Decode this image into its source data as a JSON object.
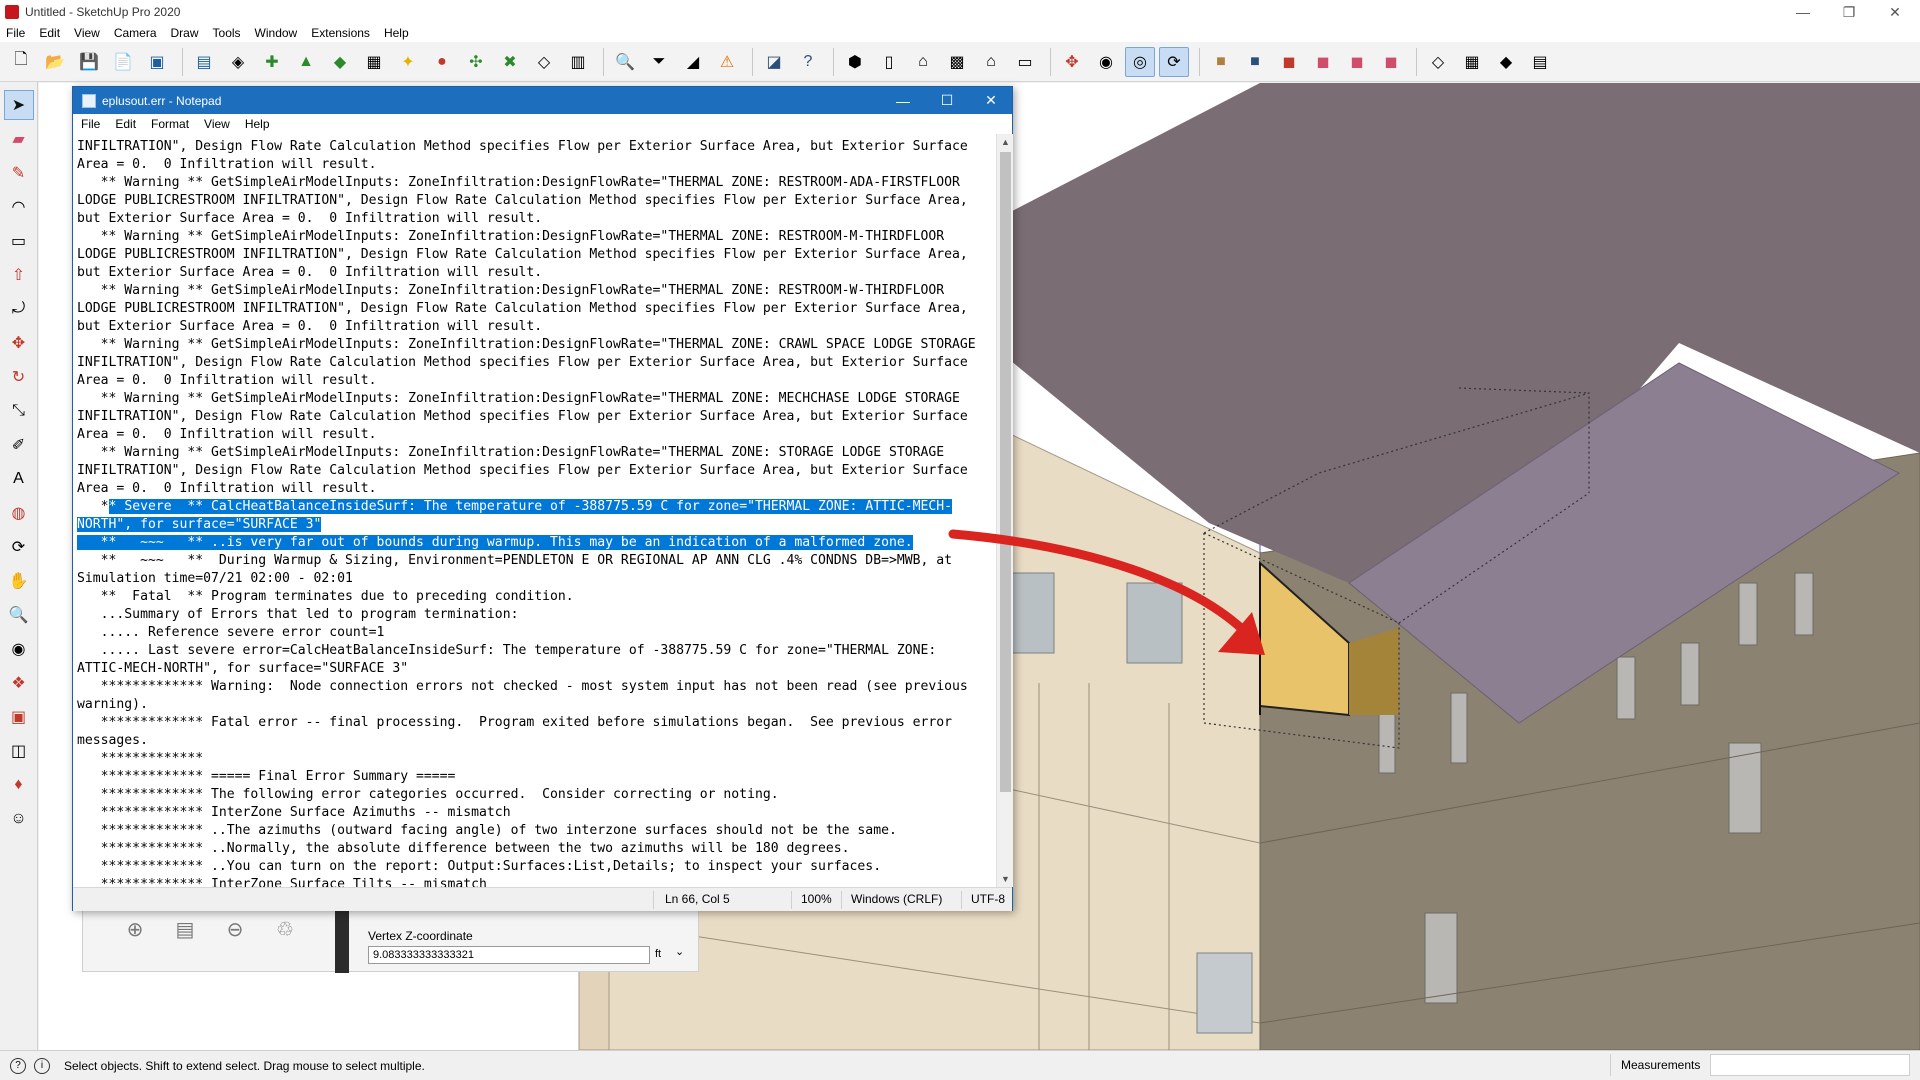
{
  "window": {
    "title": "Untitled - SketchUp Pro 2020",
    "controls": {
      "minimize": "—",
      "restore": "❐",
      "close": "✕"
    }
  },
  "menubar": [
    "File",
    "Edit",
    "View",
    "Camera",
    "Draw",
    "Tools",
    "Window",
    "Extensions",
    "Help"
  ],
  "toolbar_icons": [
    "new-file-icon",
    "open-folder-icon",
    "save-icon",
    "open-idf-icon",
    "idf-icon",
    "idf-export-icon",
    "space-icon",
    "thermal-zone-icon",
    "building-icon",
    "construction-icon",
    "schedule-icon",
    "light-icon",
    "air-loop-icon",
    "plant-loop-icon",
    "water-icon",
    "shading-icon",
    "grid-icon",
    "search-icon",
    "filter-icon",
    "render-mode-icon",
    "warning-icon",
    "inspector-icon",
    "help-icon",
    "iso-view-icon",
    "front-view-icon",
    "house-icon",
    "building-view-icon",
    "house-outline-icon",
    "garage-icon",
    "move-icon",
    "zoom-extents-icon",
    "zoom-window-icon",
    "orbit-icon",
    "box-icon",
    "box-dark-icon",
    "shape-red-icon",
    "shape-pink-icon",
    "shape-pink2-icon",
    "shape-pink3-icon",
    "wireframe-icon",
    "grid-cube-icon",
    "solid-cube-icon",
    "calendar-icon"
  ],
  "left_tools": [
    "select-arrow-icon",
    "eraser-icon",
    "pencil-icon",
    "arc-icon",
    "rectangle-icon",
    "push-pull-icon",
    "offset-icon",
    "move-icon",
    "rotate-icon",
    "scale-icon",
    "tape-measure-icon",
    "text-icon",
    "paint-bucket-icon",
    "orbit-icon",
    "pan-icon",
    "zoom-icon",
    "zoom-extents-icon",
    "component-icon",
    "warehouse-icon",
    "extension-icon",
    "ruby-icon",
    "profile-icon"
  ],
  "notepad": {
    "title": "eplusout.err - Notepad",
    "menu": [
      "File",
      "Edit",
      "Format",
      "View",
      "Help"
    ],
    "lines": [
      "INFILTRATION\", Design Flow Rate Calculation Method specifies Flow per Exterior Surface Area, but Exterior Surface",
      "Area = 0.  0 Infiltration will result.",
      "   ** Warning ** GetSimpleAirModelInputs: ZoneInfiltration:DesignFlowRate=\"THERMAL ZONE: RESTROOM-ADA-FIRSTFLOOR",
      "LODGE PUBLICRESTROOM INFILTRATION\", Design Flow Rate Calculation Method specifies Flow per Exterior Surface Area,",
      "but Exterior Surface Area = 0.  0 Infiltration will result.",
      "   ** Warning ** GetSimpleAirModelInputs: ZoneInfiltration:DesignFlowRate=\"THERMAL ZONE: RESTROOM-M-THIRDFLOOR",
      "LODGE PUBLICRESTROOM INFILTRATION\", Design Flow Rate Calculation Method specifies Flow per Exterior Surface Area,",
      "but Exterior Surface Area = 0.  0 Infiltration will result.",
      "   ** Warning ** GetSimpleAirModelInputs: ZoneInfiltration:DesignFlowRate=\"THERMAL ZONE: RESTROOM-W-THIRDFLOOR",
      "LODGE PUBLICRESTROOM INFILTRATION\", Design Flow Rate Calculation Method specifies Flow per Exterior Surface Area,",
      "but Exterior Surface Area = 0.  0 Infiltration will result.",
      "   ** Warning ** GetSimpleAirModelInputs: ZoneInfiltration:DesignFlowRate=\"THERMAL ZONE: CRAWL SPACE LODGE STORAGE",
      "INFILTRATION\", Design Flow Rate Calculation Method specifies Flow per Exterior Surface Area, but Exterior Surface",
      "Area = 0.  0 Infiltration will result.",
      "   ** Warning ** GetSimpleAirModelInputs: ZoneInfiltration:DesignFlowRate=\"THERMAL ZONE: MECHCHASE LODGE STORAGE",
      "INFILTRATION\", Design Flow Rate Calculation Method specifies Flow per Exterior Surface Area, but Exterior Surface",
      "Area = 0.  0 Infiltration will result.",
      "   ** Warning ** GetSimpleAirModelInputs: ZoneInfiltration:DesignFlowRate=\"THERMAL ZONE: STORAGE LODGE STORAGE",
      "INFILTRATION\", Design Flow Rate Calculation Method specifies Flow per Exterior Surface Area, but Exterior Surface",
      "Area = 0.  0 Infiltration will result.",
      "   *",
      "",
      "   **   ~~~   ** ..is very far out of bounds during warmup. This may be an indication of a malformed zone.",
      "   **   ~~~   **  During Warmup & Sizing, Environment=PENDLETON E OR REGIONAL AP ANN CLG .4% CONDNS DB=>MWB, at",
      "Simulation time=07/21 02:00 - 02:01",
      "   **  Fatal  ** Program terminates due to preceding condition.",
      "   ...Summary of Errors that led to program termination:",
      "   ..... Reference severe error count=1",
      "   ..... Last severe error=CalcHeatBalanceInsideSurf: The temperature of -388775.59 C for zone=\"THERMAL ZONE:",
      "ATTIC-MECH-NORTH\", for surface=\"SURFACE 3\"",
      "   ************* Warning:  Node connection errors not checked - most system input has not been read (see previous",
      "warning).",
      "   ************* Fatal error -- final processing.  Program exited before simulations began.  See previous error",
      "messages.",
      "   *************",
      "   ************* ===== Final Error Summary =====",
      "   ************* The following error categories occurred.  Consider correcting or noting.",
      "   ************* InterZone Surface Azimuths -- mismatch",
      "   ************* ..The azimuths (outward facing angle) of two interzone surfaces should not be the same.",
      "   ************* ..Normally, the absolute difference between the two azimuths will be 180 degrees.",
      "   ************* ..You can turn on the report: Output:Surfaces:List,Details; to inspect your surfaces.",
      "   ************* InterZone Surface Tilts -- mismatch"
    ],
    "highlight": {
      "line20": "* Severe  ** CalcHeatBalanceInsideSurf: The temperature of -388775.59 C for zone=\"THERMAL ZONE: ATTIC-MECH-",
      "line21": "NORTH\", for surface=\"SURFACE 3\"",
      "line22_prefix": "   **   ~~~   ** ..is very far out of bounds during warmup. This may be an indication of a malformed zone."
    },
    "status": {
      "position": "Ln 66, Col 5",
      "zoom": "100%",
      "line_ending": "Windows (CRLF)",
      "encoding": "UTF-8"
    }
  },
  "entity_info": {
    "vertex_label": "Vertex Z-coordinate",
    "vertex_value": "9.083333333333321",
    "unit": "ft"
  },
  "statusbar": {
    "text": "Select objects. Shift to extend select. Drag mouse to select multiple.",
    "measurements_label": "Measurements"
  },
  "colors": {
    "highlight": "#0078d7",
    "roof": "#7a6d74",
    "roof_light": "#8d7f92",
    "wall_light": "#e9dcc4",
    "wall_dark": "#8c8272",
    "selected_face": "#e8c36a",
    "arrow": "#d9241f"
  }
}
